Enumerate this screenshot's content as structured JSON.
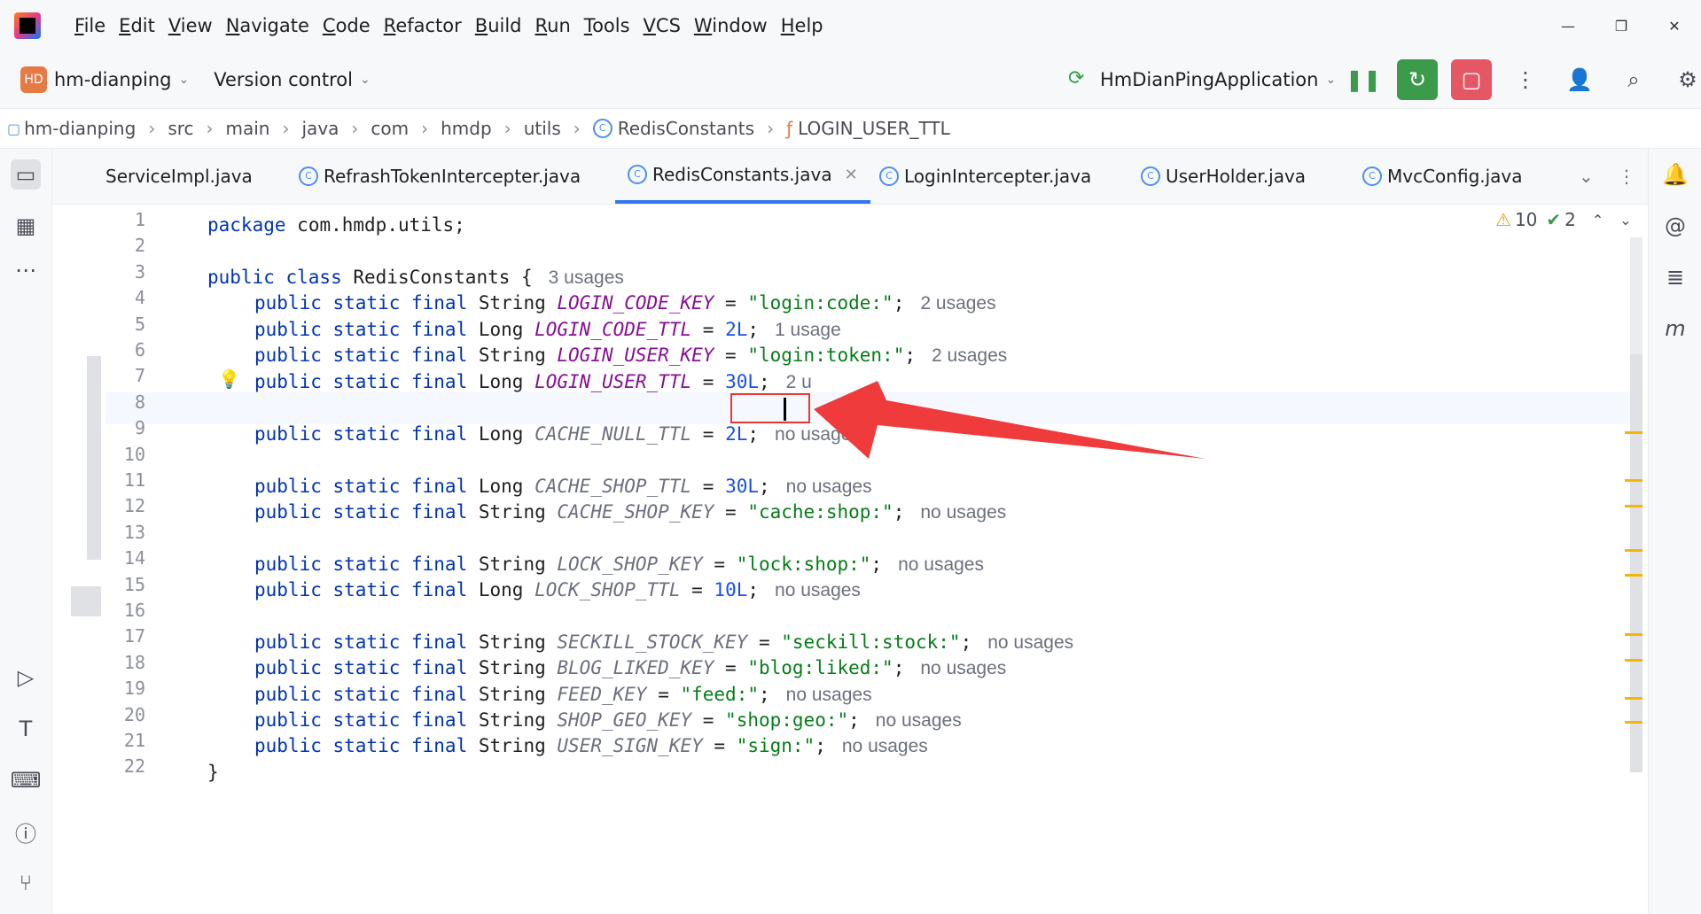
{
  "menu": [
    "File",
    "Edit",
    "View",
    "Navigate",
    "Code",
    "Refactor",
    "Build",
    "Run",
    "Tools",
    "VCS",
    "Window",
    "Help"
  ],
  "toolbar": {
    "project_badge": "HD",
    "project_name": "hm-dianping",
    "version_control": "Version control",
    "run_config": "HmDianPingApplication"
  },
  "breadcrumb": [
    "hm-dianping",
    "src",
    "main",
    "java",
    "com",
    "hmdp",
    "utils",
    "RedisConstants",
    "LOGIN_USER_TTL"
  ],
  "tabs": [
    {
      "label": "ServiceImpl.java"
    },
    {
      "label": "RefrashTokenIntercepter.java"
    },
    {
      "label": "RedisConstants.java",
      "active": true
    },
    {
      "label": "LoginIntercepter.java"
    },
    {
      "label": "UserHolder.java"
    },
    {
      "label": "MvcConfig.java"
    }
  ],
  "inspections": {
    "warnings": "10",
    "ok": "2"
  },
  "code": {
    "l1_pkg": "com.hmdp.utils;",
    "l3_class": "RedisConstants {",
    "l3_hint": "3 usages",
    "l4_name": "LOGIN_CODE_KEY",
    "l4_val": "\"login:code:\"",
    "l4_hint": "2 usages",
    "l5_name": "LOGIN_CODE_TTL",
    "l5_val": "2L",
    "l5_hint": "1 usage",
    "l6_name": "LOGIN_USER_KEY",
    "l6_val": "\"login:token:\"",
    "l6_hint": "2 usages",
    "l7_name": "LOGIN_USER_TTL",
    "l7_val": "30L",
    "l7_hint": "2 u",
    "l9_name": "CACHE_NULL_TTL",
    "l9_val": "2L",
    "l9_hint": "no usages",
    "l11_name": "CACHE_SHOP_TTL",
    "l11_val": "30L",
    "l11_hint": "no usages",
    "l12_name": "CACHE_SHOP_KEY",
    "l12_val": "\"cache:shop:\"",
    "l12_hint": "no usages",
    "l14_name": "LOCK_SHOP_KEY",
    "l14_val": "\"lock:shop:\"",
    "l14_hint": "no usages",
    "l15_name": "LOCK_SHOP_TTL",
    "l15_val": "10L",
    "l15_hint": "no usages",
    "l17_name": "SECKILL_STOCK_KEY",
    "l17_val": "\"seckill:stock:\"",
    "l17_hint": "no usages",
    "l18_name": "BLOG_LIKED_KEY",
    "l18_val": "\"blog:liked:\"",
    "l18_hint": "no usages",
    "l19_name": "FEED_KEY",
    "l19_val": "\"feed:\"",
    "l19_hint": "no usages",
    "l20_name": "SHOP_GEO_KEY",
    "l20_val": "\"shop:geo:\"",
    "l20_hint": "no usages",
    "l21_name": "USER_SIGN_KEY",
    "l21_val": "\"sign:\"",
    "l21_hint": "no usages",
    "l22": "}"
  },
  "line_numbers": [
    "1",
    "2",
    "3",
    "4",
    "5",
    "6",
    "7",
    "8",
    "9",
    "10",
    "11",
    "12",
    "13",
    "14",
    "15",
    "16",
    "17",
    "18",
    "19",
    "20",
    "21",
    "22"
  ],
  "colors": {
    "accent": "#3574f0",
    "keyword": "#0033b3",
    "constant": "#871094",
    "string": "#067d17",
    "number": "#1750eb",
    "annotation_red": "#e53935"
  }
}
